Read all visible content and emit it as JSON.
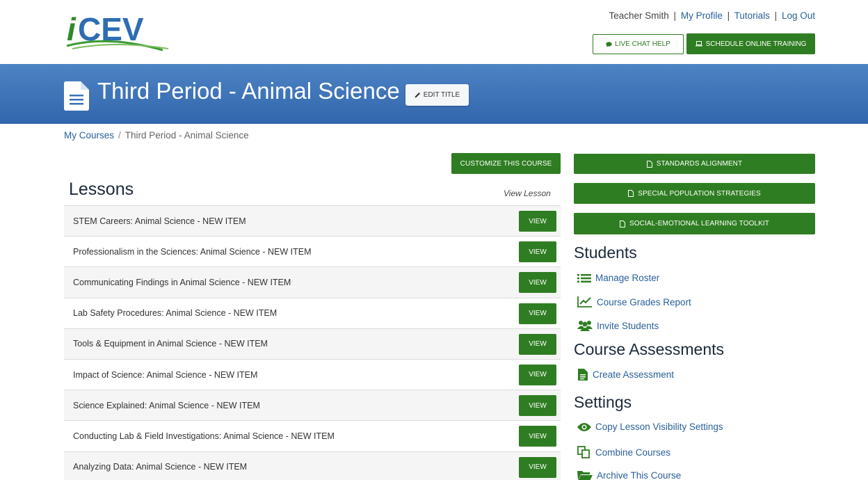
{
  "header": {
    "logo_text": "iCEV",
    "user_name": "Teacher Smith",
    "links": [
      "My Profile",
      "Tutorials",
      "Log Out"
    ],
    "separator": "|",
    "live_chat_label": "LIVE CHAT HELP",
    "schedule_label": "SCHEDULE ONLINE TRAINING"
  },
  "banner": {
    "title": "Third Period - Animal Science",
    "edit_label": "EDIT TITLE"
  },
  "breadcrumb": {
    "home": "My Courses",
    "separator": "/",
    "current": "Third Period - Animal Science"
  },
  "main": {
    "customize_label": "CUSTOMIZE THIS COURSE",
    "lessons_title": "Lessons",
    "view_lesson_header": "View Lesson",
    "view_label": "VIEW",
    "lessons": [
      "STEM Careers: Animal Science - NEW ITEM",
      "Professionalism in the Sciences: Animal Science - NEW ITEM",
      "Communicating Findings in Animal Science - NEW ITEM",
      "Lab Safety Procedures: Animal Science - NEW ITEM",
      "Tools & Equipment in Animal Science - NEW ITEM",
      "Impact of Science: Animal Science - NEW ITEM",
      "Science Explained: Animal Science - NEW ITEM",
      "Conducting Lab & Field Investigations: Animal Science - NEW ITEM",
      "Analyzing Data: Animal Science - NEW ITEM"
    ]
  },
  "sidebar": {
    "resources": [
      "STANDARDS ALIGNMENT",
      "SPECIAL POPULATION STRATEGIES",
      "SOCIAL-EMOTIONAL LEARNING TOOLKIT"
    ],
    "students_title": "Students",
    "students_links": [
      "Manage Roster",
      "Course Grades Report",
      "Invite Students"
    ],
    "assessments_title": "Course Assessments",
    "assessments_links": [
      "Create Assessment"
    ],
    "settings_title": "Settings",
    "settings_links": [
      "Copy Lesson Visibility Settings",
      "Combine Courses",
      "Archive This Course"
    ]
  },
  "colors": {
    "brand_green": "#2f7d22",
    "banner_blue": "#3a72b8",
    "link_blue": "#2a6099",
    "icon_green": "#2f7d22"
  },
  "icons": {
    "chat": "chat-bubble-icon",
    "schedule": "laptop-icon",
    "edit": "pencil-icon",
    "document": "document-icon",
    "resource": "file-icon",
    "manage_roster": "list-icon",
    "grades": "line-chart-icon",
    "invite": "users-icon",
    "assessment": "file-text-icon",
    "visibility": "eye-icon",
    "combine": "copy-icon",
    "archive": "folder-open-icon"
  }
}
